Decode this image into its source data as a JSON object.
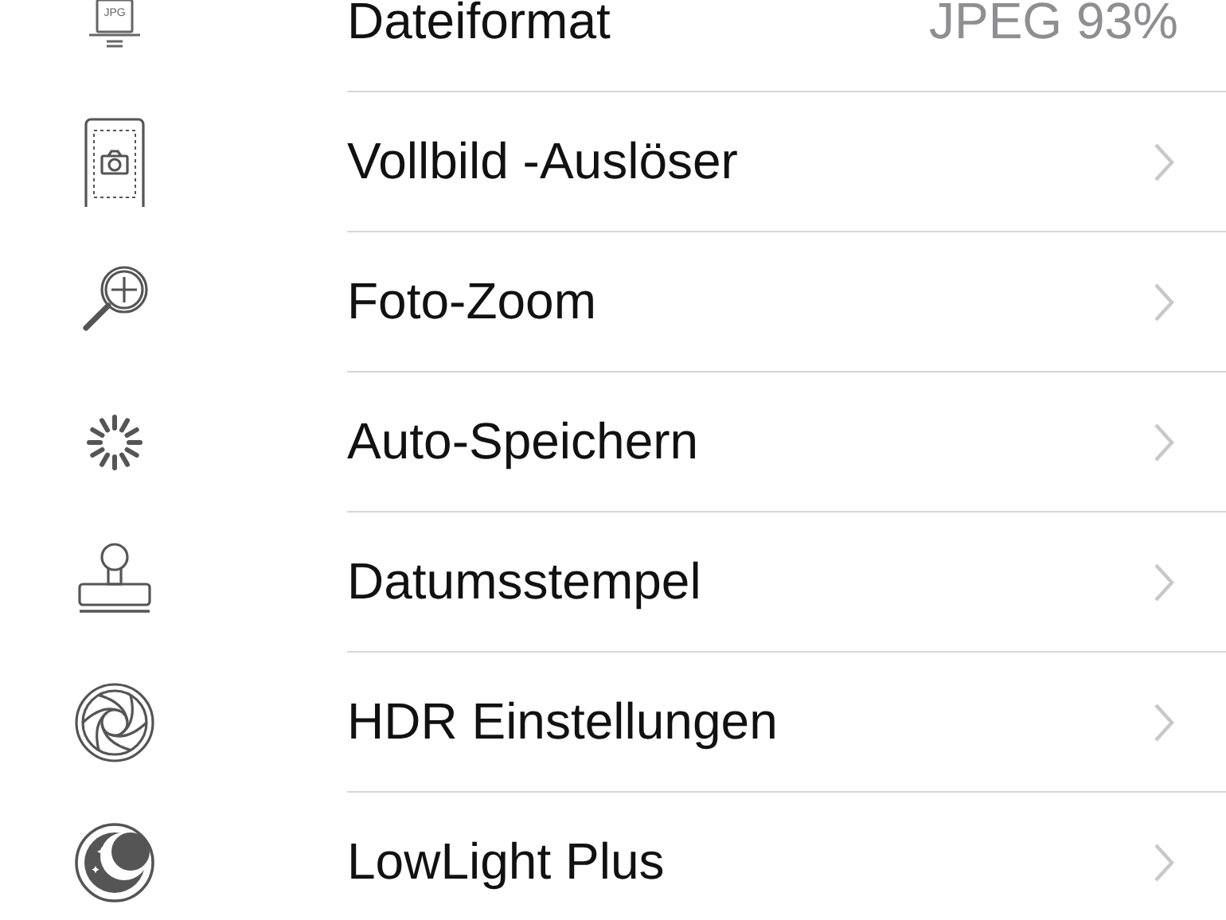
{
  "settings": [
    {
      "icon_text": "JPG",
      "label": "Dateiformat",
      "value": "JPEG 93%"
    },
    {
      "label": "Vollbild -Auslöser"
    },
    {
      "label": "Foto-Zoom"
    },
    {
      "label": "Auto-Speichern"
    },
    {
      "label": "Datumsstempel"
    },
    {
      "label": "HDR Einstellungen"
    },
    {
      "label": "LowLight Plus"
    }
  ]
}
